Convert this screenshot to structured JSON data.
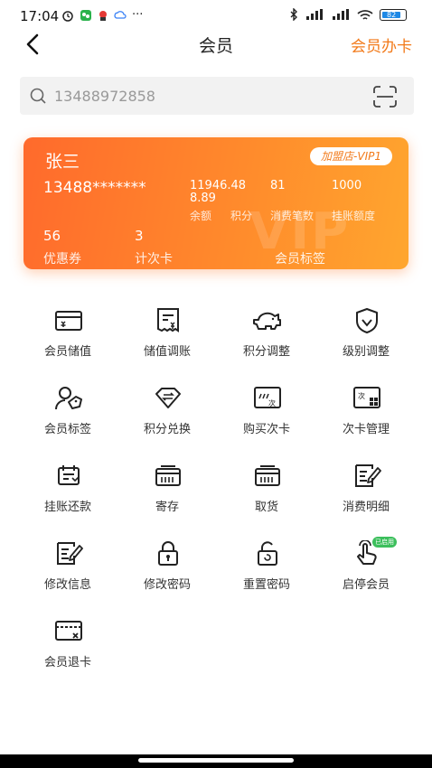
{
  "status_bar": {
    "time": "17:04",
    "dots": "···",
    "battery": "82"
  },
  "header": {
    "title": "会员",
    "action": "会员办卡"
  },
  "search": {
    "value": "13488972858"
  },
  "card": {
    "name": "张三",
    "badge": "加盟店-VIP1",
    "phone": "13488*******",
    "watermark": "VIP",
    "stats": [
      {
        "value": "11946.48\n8.89",
        "label": "余额"
      },
      {
        "value": "",
        "label": "积分"
      },
      {
        "value": "81",
        "label": "消费笔数"
      },
      {
        "value": "1000",
        "label": "挂账额度"
      }
    ],
    "balance_line1": "11946.48",
    "balance_line2": "8.89",
    "points_value": "",
    "bottom": [
      {
        "value": "56",
        "label": "优惠券"
      },
      {
        "value": "3",
        "label": "计次卡"
      },
      {
        "value": "",
        "label": "会员标签"
      }
    ]
  },
  "menu": [
    {
      "label": "会员储值",
      "icon": "card-yen-icon"
    },
    {
      "label": "储值调账",
      "icon": "receipt-yen-icon"
    },
    {
      "label": "积分调整",
      "icon": "piggy-bank-icon"
    },
    {
      "label": "级别调整",
      "icon": "shield-check-icon"
    },
    {
      "label": "会员标签",
      "icon": "user-tag-icon"
    },
    {
      "label": "积分兑换",
      "icon": "diamond-exchange-icon"
    },
    {
      "label": "购买次卡",
      "icon": "buy-times-card-icon"
    },
    {
      "label": "次卡管理",
      "icon": "times-card-manage-icon"
    },
    {
      "label": "挂账还款",
      "icon": "repayment-icon"
    },
    {
      "label": "寄存",
      "icon": "deposit-box-icon"
    },
    {
      "label": "取货",
      "icon": "pickup-box-icon"
    },
    {
      "label": "消费明细",
      "icon": "edit-list-icon"
    },
    {
      "label": "修改信息",
      "icon": "edit-info-icon"
    },
    {
      "label": "修改密码",
      "icon": "lock-icon"
    },
    {
      "label": "重置密码",
      "icon": "reset-lock-icon"
    },
    {
      "label": "启停会员",
      "icon": "hand-toggle-icon",
      "badge": "已启用"
    },
    {
      "label": "会员退卡",
      "icon": "card-close-icon"
    }
  ],
  "colors": {
    "accent": "#f27a1a",
    "card_start": "#ff6a2c",
    "card_end": "#ffa62e",
    "enabled": "#3cbf5c"
  }
}
